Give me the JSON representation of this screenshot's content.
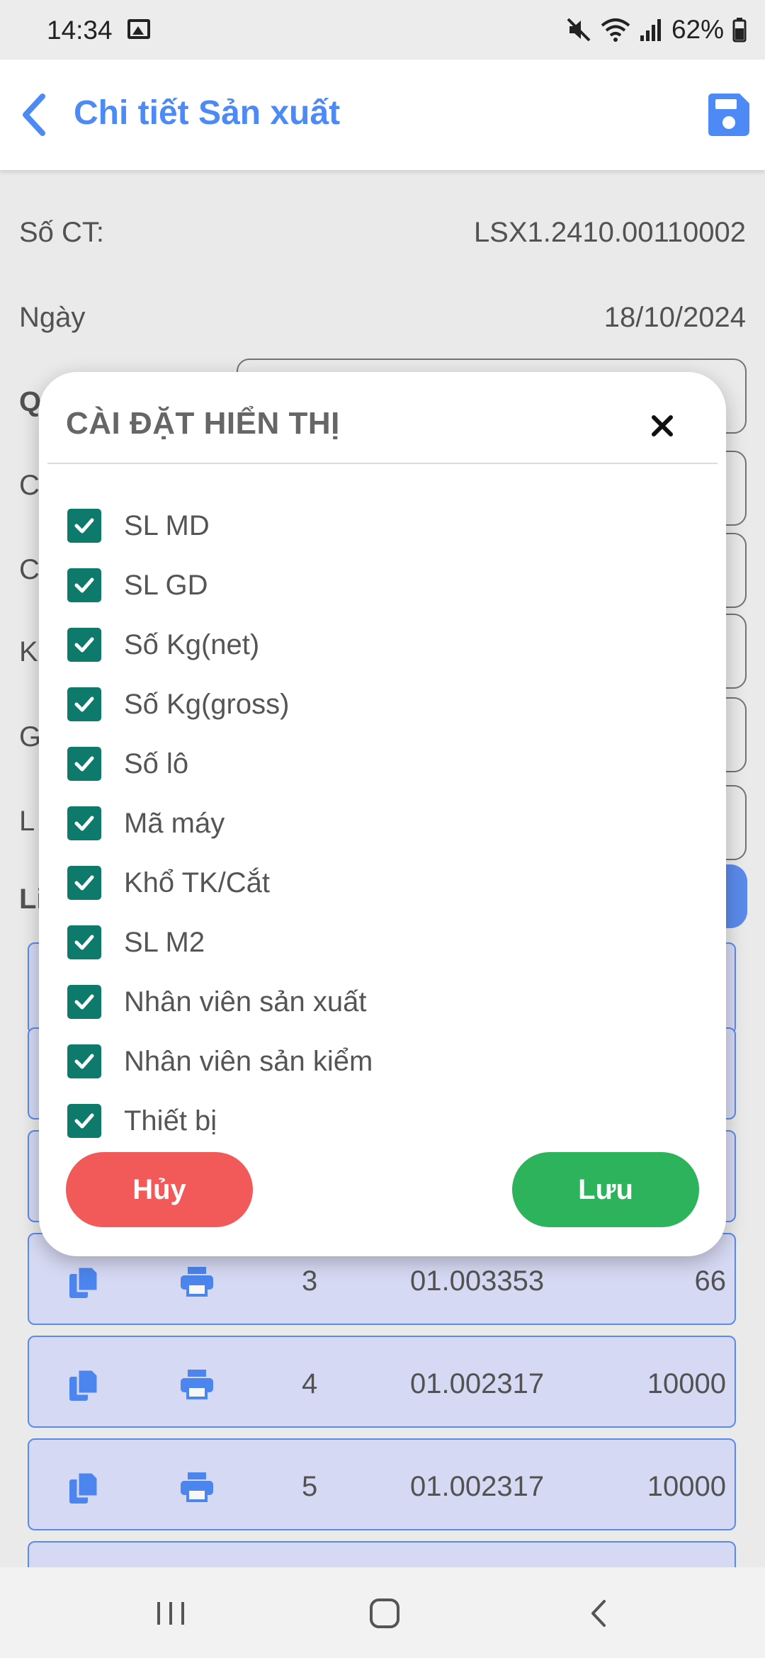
{
  "status_bar": {
    "time": "14:34",
    "battery": "62%",
    "icons": [
      "gallery-icon",
      "mute-icon",
      "wifi-icon",
      "signal-icon",
      "battery-icon"
    ]
  },
  "app_bar": {
    "title": "Chi tiết Sản xuất",
    "back_icon": "chevron-left-icon",
    "save_icon": "floppy-disk-icon",
    "accent": "#4e8af5"
  },
  "form": {
    "doc_no_label": "Số CT:",
    "doc_no_value": "LSX1.2410.00110002",
    "date_label": "Ngày",
    "date_value": "18/10/2024",
    "partial_labels": [
      "Q",
      "C",
      "C",
      "K",
      "G",
      "L",
      "Li"
    ]
  },
  "list_rows": [
    {
      "index": "3",
      "code": "01.003353",
      "qty": "66"
    },
    {
      "index": "4",
      "code": "01.002317",
      "qty": "10000"
    },
    {
      "index": "5",
      "code": "01.002317",
      "qty": "10000"
    }
  ],
  "dialog": {
    "title": "CÀI ĐẶT HIỂN THỊ",
    "close_icon": "close-icon",
    "options": [
      {
        "label": "SL MD",
        "checked": true
      },
      {
        "label": "SL GD",
        "checked": true
      },
      {
        "label": "Số Kg(net)",
        "checked": true
      },
      {
        "label": "Số Kg(gross)",
        "checked": true
      },
      {
        "label": "Số lô",
        "checked": true
      },
      {
        "label": "Mã máy",
        "checked": true
      },
      {
        "label": "Khổ TK/Cắt",
        "checked": true
      },
      {
        "label": "SL M2",
        "checked": true
      },
      {
        "label": "Nhân viên sản xuất",
        "checked": true
      },
      {
        "label": "Nhân viên sản kiểm",
        "checked": true
      },
      {
        "label": "Thiết bị",
        "checked": true
      }
    ],
    "cancel_label": "Hủy",
    "save_label": "Lưu",
    "checkbox_color": "#0e7a6b",
    "cancel_color": "#f25a5a",
    "save_color": "#2db35c"
  },
  "nav_bar": {
    "icons": [
      "recent-apps-icon",
      "home-icon",
      "back-icon"
    ]
  }
}
